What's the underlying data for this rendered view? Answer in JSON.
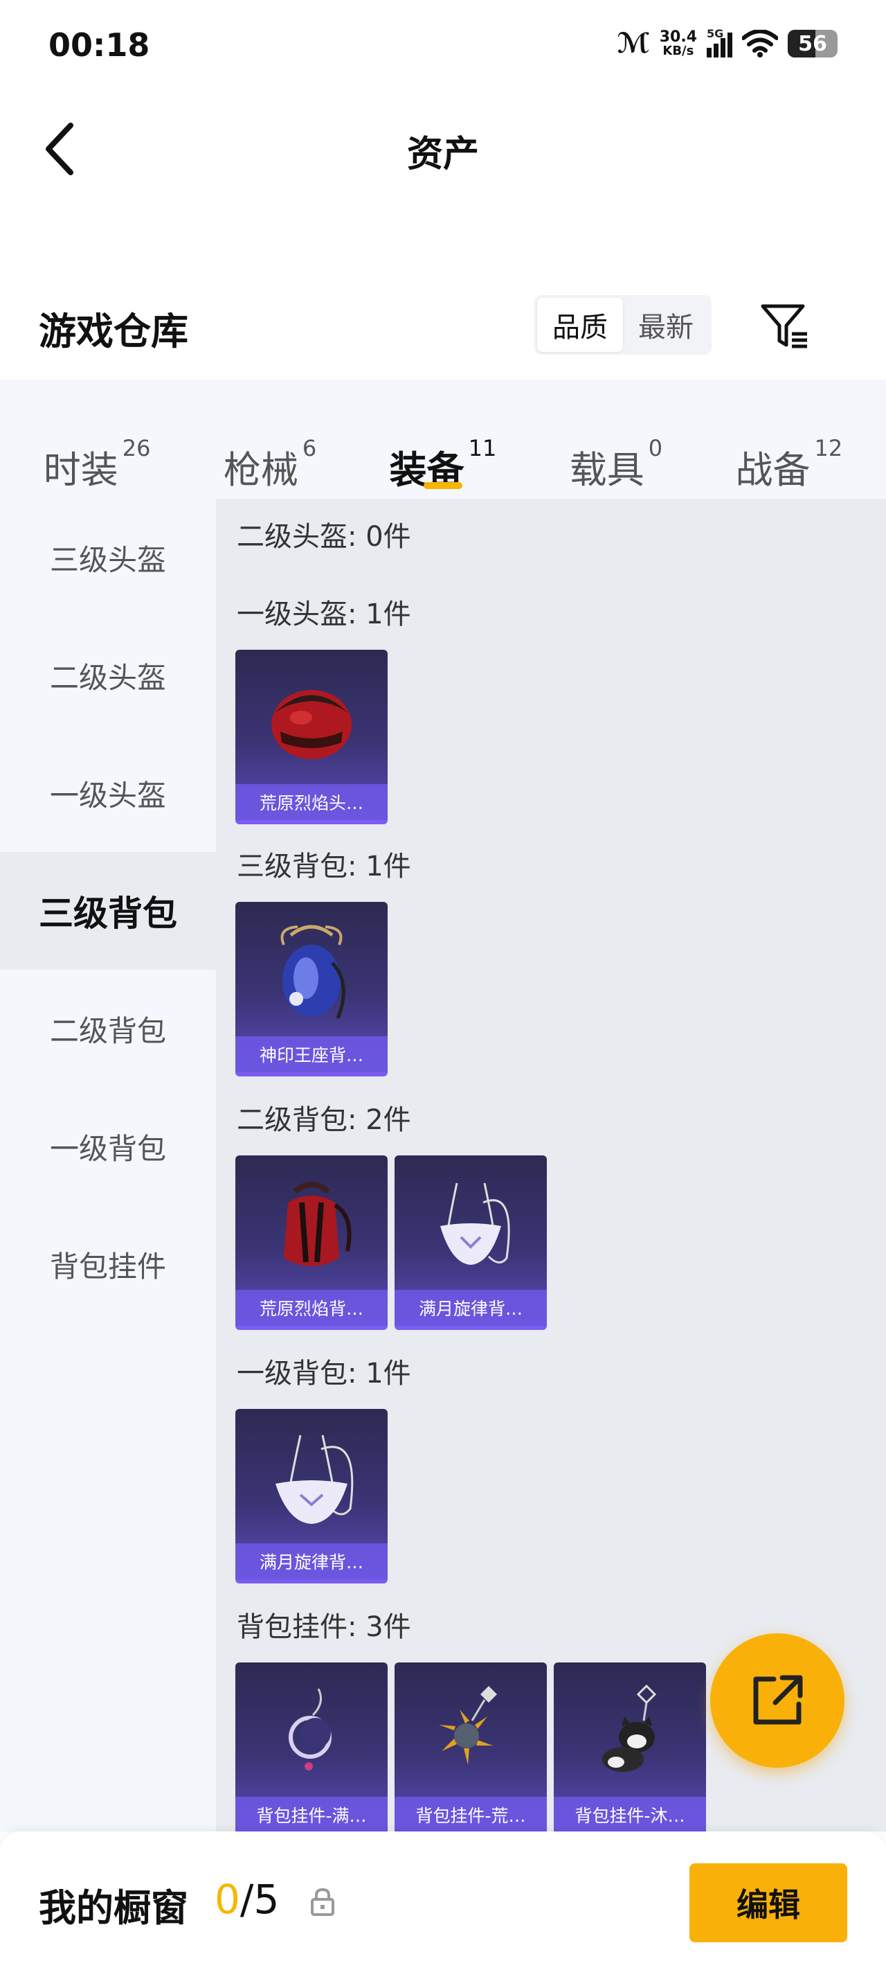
{
  "status_bar": {
    "time": "00:18",
    "net_speed_value": "30.4",
    "net_speed_unit": "KB/s",
    "signal_label": "5G",
    "battery": "56"
  },
  "header": {
    "title": "资产"
  },
  "section": {
    "title": "游戏仓库",
    "sort_options": [
      "品质",
      "最新"
    ],
    "active_sort": "品质"
  },
  "tabs": [
    {
      "label": "时装",
      "count": "26"
    },
    {
      "label": "枪械",
      "count": "6"
    },
    {
      "label": "装备",
      "count": "11"
    },
    {
      "label": "载具",
      "count": "0"
    },
    {
      "label": "战备",
      "count": "12"
    }
  ],
  "active_tab": "装备",
  "sidebar": {
    "items": [
      "三级头盔",
      "二级头盔",
      "一级头盔",
      "三级背包",
      "二级背包",
      "一级背包",
      "背包挂件"
    ],
    "active": "三级背包"
  },
  "groups": [
    {
      "title": "二级头盔: 0件",
      "items": []
    },
    {
      "title": "一级头盔: 1件",
      "items": [
        {
          "name": "荒原烈焰头…",
          "icon": "helmet-icon"
        }
      ]
    },
    {
      "title": "三级背包: 1件",
      "items": [
        {
          "name": "神印王座背…",
          "icon": "backpack-icon"
        }
      ]
    },
    {
      "title": "二级背包: 2件",
      "items": [
        {
          "name": "荒原烈焰背…",
          "icon": "backpack-icon"
        },
        {
          "name": "满月旋律背…",
          "icon": "backpack-icon"
        }
      ]
    },
    {
      "title": "一级背包: 1件",
      "items": [
        {
          "name": "满月旋律背…",
          "icon": "backpack-icon"
        }
      ]
    },
    {
      "title": "背包挂件: 3件",
      "items": [
        {
          "name": "背包挂件-满…",
          "icon": "charm-icon"
        },
        {
          "name": "背包挂件-荒…",
          "icon": "charm-icon"
        },
        {
          "name": "背包挂件-沐…",
          "icon": "charm-icon"
        }
      ]
    }
  ],
  "bottom_bar": {
    "label": "我的橱窗",
    "current": "0",
    "separator": "/",
    "total": "5",
    "edit_label": "编辑"
  },
  "colors": {
    "accent": "#f7b500",
    "fab": "#f9b10a",
    "card_dark": "#2d2a52",
    "card_light": "#5a4bb8",
    "name_bar": "#6e58e6"
  }
}
